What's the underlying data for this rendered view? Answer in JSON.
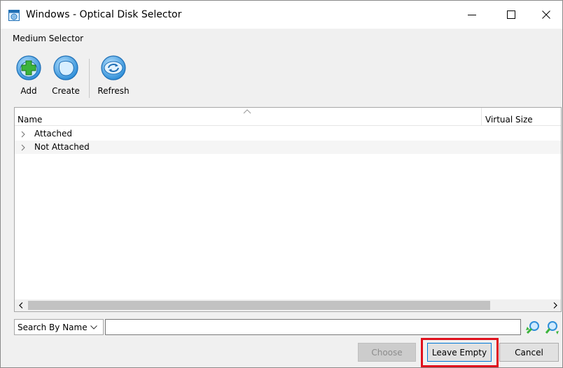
{
  "window": {
    "title": "Windows - Optical Disk Selector"
  },
  "section_label": "Medium Selector",
  "toolbar": {
    "add": "Add",
    "create": "Create",
    "refresh": "Refresh"
  },
  "tree": {
    "columns": {
      "name": "Name",
      "virtual_size": "Virtual Size"
    },
    "rows": [
      {
        "label": "Attached"
      },
      {
        "label": "Not Attached"
      }
    ]
  },
  "search": {
    "mode": "Search By Name",
    "value": ""
  },
  "buttons": {
    "choose": "Choose",
    "leave_empty": "Leave Empty",
    "cancel": "Cancel"
  },
  "colors": {
    "accent": "#0078d7",
    "icon_blue": "#2f8fd8",
    "icon_green": "#3cb43c",
    "highlight_box": "#e0101c"
  },
  "icons": {
    "app": "optical-disk-icon",
    "minimize": "minimize-icon",
    "maximize": "maximize-icon",
    "close": "close-icon",
    "add": "add-disk-icon",
    "create": "create-disk-icon",
    "refresh": "refresh-icon",
    "search_prev": "search-backward-icon",
    "search_next": "search-forward-icon"
  }
}
